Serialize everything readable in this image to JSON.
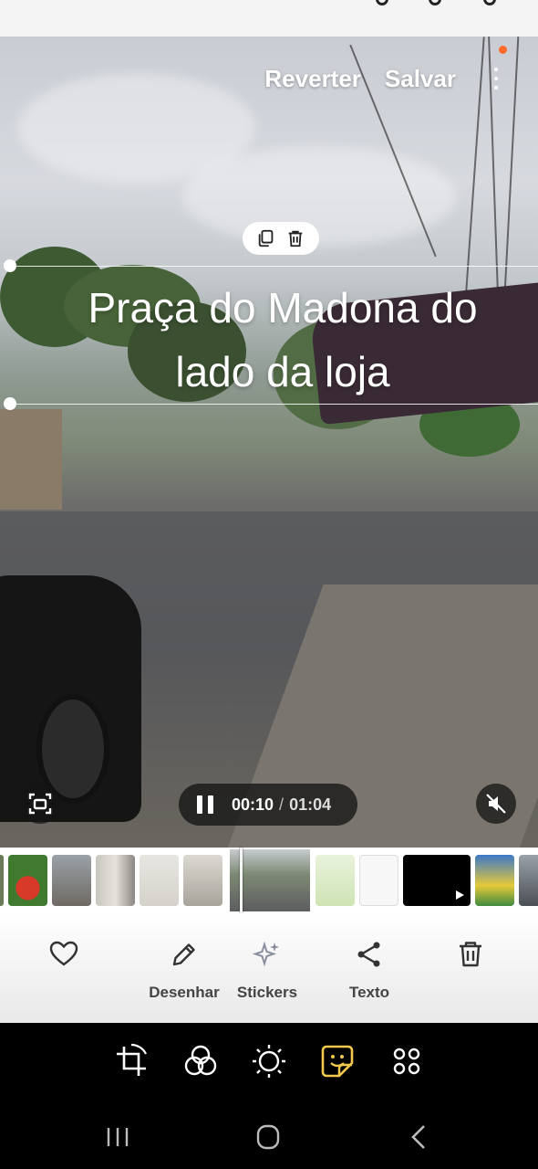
{
  "editor": {
    "revert_label": "Reverter",
    "save_label": "Salvar"
  },
  "text_overlay": {
    "line1": "Praça do Madona do",
    "line2": "lado da loja"
  },
  "player": {
    "current_time": "00:10",
    "separator": "/",
    "total_time": "01:04",
    "state": "playing"
  },
  "actions": {
    "favorite": "",
    "draw": "Desenhar",
    "stickers": "Stickers",
    "text": "Texto",
    "delete": ""
  },
  "tools": [
    "rotate-crop-icon",
    "filters-icon",
    "brightness-icon",
    "sticker-icon",
    "more-tools-icon"
  ],
  "colors": {
    "accent_active_tool": "#f2c94c",
    "notification_dot": "#ff6a2b",
    "label_text": "#444444"
  }
}
